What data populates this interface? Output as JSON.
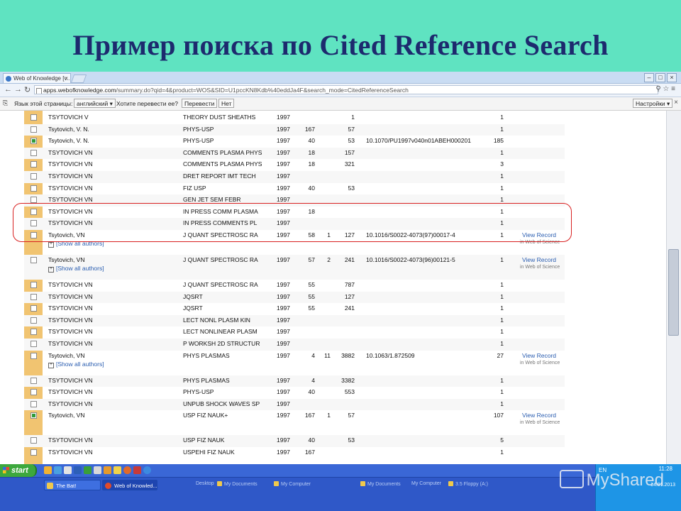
{
  "slide": {
    "title": "Пример поиска по Cited Reference Search"
  },
  "browser": {
    "tab_title": "Web of Knowledge [v...",
    "url_host": "apps.webofknowledge.com",
    "url_path": "/summary.do?qid=4&product=WOS&SID=U1pccKN8Kdb%40eddJa4F&search_mode=CitedReferenceSearch",
    "translate_bar": {
      "label": "Язык этой страницы:",
      "language": "английский",
      "question": "Хотите перевести ее?",
      "translate_button": "Перевести",
      "no_button": "Нет",
      "settings_button": "Настройки"
    }
  },
  "table": {
    "view_record_label": "View Record",
    "view_record_sub": "in Web of Science",
    "show_all_label": "[Show all authors]",
    "rows": [
      {
        "checked": false,
        "author": "TSYTOVICH V",
        "work": "THEORY DUST SHEATHS",
        "year": "1997",
        "vol": "",
        "page_a": "",
        "page": "1",
        "doi": "",
        "cites": "1",
        "view": false
      },
      {
        "checked": false,
        "author": "Tsytovich, V. N.",
        "work": "PHYS-USP",
        "year": "1997",
        "vol": "167",
        "page_a": "",
        "page": "57",
        "doi": "",
        "cites": "1",
        "view": false
      },
      {
        "checked": true,
        "author": "Tsytovich, V. N.",
        "work": "PHYS-USP",
        "year": "1997",
        "vol": "40",
        "page_a": "",
        "page": "53",
        "doi": "10.1070/PU1997v040n01ABEH000201",
        "cites": "185",
        "view": false
      },
      {
        "checked": false,
        "author": "TSYTOVICH VN",
        "work": "COMMENTS PLASMA PHYS",
        "year": "1997",
        "vol": "18",
        "page_a": "",
        "page": "157",
        "doi": "",
        "cites": "1",
        "view": false
      },
      {
        "checked": false,
        "author": "TSYTOVICH VN",
        "work": "COMMENTS PLASMA PHYS",
        "year": "1997",
        "vol": "18",
        "page_a": "",
        "page": "321",
        "doi": "",
        "cites": "3",
        "view": false
      },
      {
        "checked": false,
        "author": "TSYTOVICH VN",
        "work": "DRET REPORT IMT TECH",
        "year": "1997",
        "vol": "",
        "page_a": "",
        "page": "",
        "doi": "",
        "cites": "1",
        "view": false
      },
      {
        "checked": false,
        "author": "TSYTOVICH VN",
        "work": "FIZ USP",
        "year": "1997",
        "vol": "40",
        "page_a": "",
        "page": "53",
        "doi": "",
        "cites": "1",
        "view": false
      },
      {
        "checked": false,
        "author": "TSYTOVICH VN",
        "work": "GEN JET SEM FEBR",
        "year": "1997",
        "vol": "",
        "page_a": "",
        "page": "",
        "doi": "",
        "cites": "1",
        "view": false
      },
      {
        "checked": false,
        "author": "TSYTOVICH VN",
        "work": "IN PRESS COMM PLASMA",
        "year": "1997",
        "vol": "18",
        "page_a": "",
        "page": "",
        "doi": "",
        "cites": "1",
        "view": false
      },
      {
        "checked": false,
        "author": "TSYTOVICH VN",
        "work": "IN PRESS COMMENTS PL",
        "year": "1997",
        "vol": "",
        "page_a": "",
        "page": "",
        "doi": "",
        "cites": "1",
        "view": false
      },
      {
        "checked": false,
        "author": "Tsytovich, VN",
        "work": "J QUANT SPECTROSC RA",
        "year": "1997",
        "vol": "58",
        "page_a": "1",
        "page": "127",
        "doi": "10.1016/S0022-4073(97)00017-4",
        "cites": "1",
        "view": true,
        "show_all": true
      },
      {
        "checked": false,
        "author": "Tsytovich, VN",
        "work": "J QUANT SPECTROSC RA",
        "year": "1997",
        "vol": "57",
        "page_a": "2",
        "page": "241",
        "doi": "10.1016/S0022-4073(96)00121-5",
        "cites": "1",
        "view": true,
        "show_all": true
      },
      {
        "checked": false,
        "author": "TSYTOVICH VN",
        "work": "J QUANT SPECTROSC RA",
        "year": "1997",
        "vol": "55",
        "page_a": "",
        "page": "787",
        "doi": "",
        "cites": "1",
        "view": false
      },
      {
        "checked": false,
        "author": "TSYTOVICH VN",
        "work": "JQSRT",
        "year": "1997",
        "vol": "55",
        "page_a": "",
        "page": "127",
        "doi": "",
        "cites": "1",
        "view": false
      },
      {
        "checked": false,
        "author": "TSYTOVICH VN",
        "work": "JQSRT",
        "year": "1997",
        "vol": "55",
        "page_a": "",
        "page": "241",
        "doi": "",
        "cites": "1",
        "view": false
      },
      {
        "checked": false,
        "author": "TSYTOVICH VN",
        "work": "LECT NONL PLASM KIN",
        "year": "1997",
        "vol": "",
        "page_a": "",
        "page": "",
        "doi": "",
        "cites": "1",
        "view": false
      },
      {
        "checked": false,
        "author": "TSYTOVICH VN",
        "work": "LECT NONLINEAR PLASM",
        "year": "1997",
        "vol": "",
        "page_a": "",
        "page": "",
        "doi": "",
        "cites": "1",
        "view": false
      },
      {
        "checked": false,
        "author": "TSYTOVICH VN",
        "work": "P WORKSH 2D STRUCTUR",
        "year": "1997",
        "vol": "",
        "page_a": "",
        "page": "",
        "doi": "",
        "cites": "1",
        "view": false
      },
      {
        "checked": false,
        "author": "Tsytovich, VN",
        "work": "PHYS PLASMAS",
        "year": "1997",
        "vol": "4",
        "page_a": "11",
        "page": "3882",
        "doi": "10.1063/1.872509",
        "cites": "27",
        "view": true,
        "show_all": true
      },
      {
        "checked": false,
        "author": "TSYTOVICH VN",
        "work": "PHYS PLASMAS",
        "year": "1997",
        "vol": "4",
        "page_a": "",
        "page": "3382",
        "doi": "",
        "cites": "1",
        "view": false
      },
      {
        "checked": false,
        "author": "TSYTOVICH VN",
        "work": "PHYS-USP",
        "year": "1997",
        "vol": "40",
        "page_a": "",
        "page": "553",
        "doi": "",
        "cites": "1",
        "view": false
      },
      {
        "checked": false,
        "author": "TSYTOVICH VN",
        "work": "UNPUB SHOCK WAVES SP",
        "year": "1997",
        "vol": "",
        "page_a": "",
        "page": "",
        "doi": "",
        "cites": "1",
        "view": false
      },
      {
        "checked": true,
        "author": "Tsytovich, VN",
        "work": "USP FIZ NAUK+",
        "year": "1997",
        "vol": "167",
        "page_a": "1",
        "page": "57",
        "doi": "",
        "cites": "107",
        "view": true,
        "show_all": false
      },
      {
        "checked": false,
        "author": "TSYTOVICH VN",
        "work": "USP FIZ NAUK",
        "year": "1997",
        "vol": "40",
        "page_a": "",
        "page": "53",
        "doi": "",
        "cites": "5",
        "view": false
      },
      {
        "checked": false,
        "author": "TSYTOVICH VN",
        "work": "USPEHI FIZ NAUK",
        "year": "1997",
        "vol": "167",
        "page_a": "",
        "page": "",
        "doi": "",
        "cites": "1",
        "view": false
      }
    ]
  },
  "taskbar": {
    "start_label": "start",
    "buttons": [
      {
        "label": "The Bat!"
      },
      {
        "label": "Web of Knowled..."
      }
    ],
    "toolbars": [
      "Desktop",
      "My Documents",
      "My Computer",
      "My Documents",
      "My Computer",
      "3.5 Floppy (A:)"
    ],
    "clock": "11:28",
    "lang": "EN",
    "date": "14.01.2013"
  },
  "watermark": {
    "text": "MyShared"
  },
  "colors": {
    "slide_bg": "#5fe3c1",
    "title": "#1d2a6e",
    "highlight": "#d82020",
    "side_col": "#f1c471",
    "link": "#2a5db0"
  }
}
